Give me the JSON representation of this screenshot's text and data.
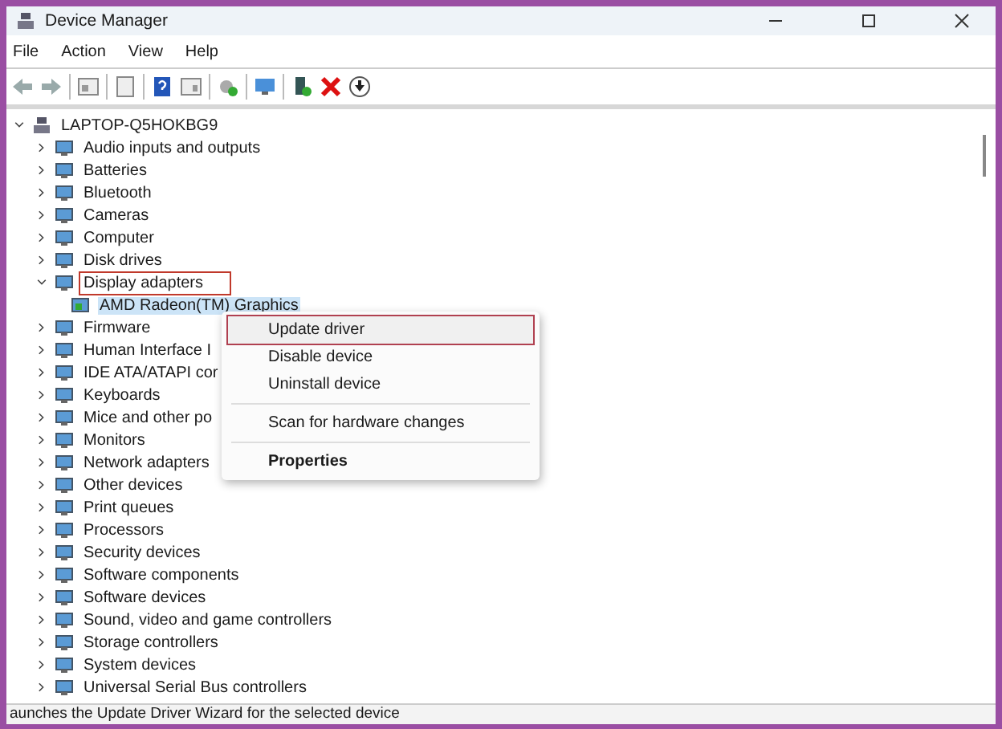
{
  "window": {
    "title": "Device Manager"
  },
  "menu": [
    "File",
    "Action",
    "View",
    "Help"
  ],
  "tree": {
    "label": "LAPTOP-Q5HOKBG9",
    "expanded": true,
    "children": [
      {
        "label": "Audio inputs and outputs",
        "expanded": false,
        "outlined": false
      },
      {
        "label": "Batteries",
        "expanded": false,
        "outlined": false
      },
      {
        "label": "Bluetooth",
        "expanded": false,
        "outlined": false
      },
      {
        "label": "Cameras",
        "expanded": false,
        "outlined": false
      },
      {
        "label": "Computer",
        "expanded": false,
        "outlined": false
      },
      {
        "label": "Disk drives",
        "expanded": false,
        "outlined": false
      },
      {
        "label": "Display adapters",
        "expanded": true,
        "outlined": true,
        "children": [
          {
            "label": "AMD Radeon(TM) Graphics",
            "selected": true
          }
        ]
      },
      {
        "label": "Firmware",
        "expanded": false,
        "outlined": false
      },
      {
        "label": "Human Interface I",
        "expanded": false,
        "outlined": false
      },
      {
        "label": "IDE ATA/ATAPI cor",
        "expanded": false,
        "outlined": false
      },
      {
        "label": "Keyboards",
        "expanded": false,
        "outlined": false
      },
      {
        "label": "Mice and other po",
        "expanded": false,
        "outlined": false
      },
      {
        "label": "Monitors",
        "expanded": false,
        "outlined": false
      },
      {
        "label": "Network adapters",
        "expanded": false,
        "outlined": false
      },
      {
        "label": "Other devices",
        "expanded": false,
        "outlined": false
      },
      {
        "label": "Print queues",
        "expanded": false,
        "outlined": false
      },
      {
        "label": "Processors",
        "expanded": false,
        "outlined": false
      },
      {
        "label": "Security devices",
        "expanded": false,
        "outlined": false
      },
      {
        "label": "Software components",
        "expanded": false,
        "outlined": false
      },
      {
        "label": "Software devices",
        "expanded": false,
        "outlined": false
      },
      {
        "label": "Sound, video and game controllers",
        "expanded": false,
        "outlined": false
      },
      {
        "label": "Storage controllers",
        "expanded": false,
        "outlined": false
      },
      {
        "label": "System devices",
        "expanded": false,
        "outlined": false
      },
      {
        "label": "Universal Serial Bus controllers",
        "expanded": false,
        "outlined": false
      }
    ]
  },
  "context_menu": {
    "items": [
      {
        "kind": "item",
        "label": "Update driver",
        "selected": true
      },
      {
        "kind": "item",
        "label": "Disable device",
        "selected": false
      },
      {
        "kind": "item",
        "label": "Uninstall device",
        "selected": false
      },
      {
        "kind": "separator"
      },
      {
        "kind": "item",
        "label": "Scan for hardware changes",
        "selected": false
      },
      {
        "kind": "separator"
      },
      {
        "kind": "default",
        "label": "Properties",
        "selected": false
      }
    ]
  },
  "status_bar": "aunches the Update Driver Wizard for the selected device"
}
